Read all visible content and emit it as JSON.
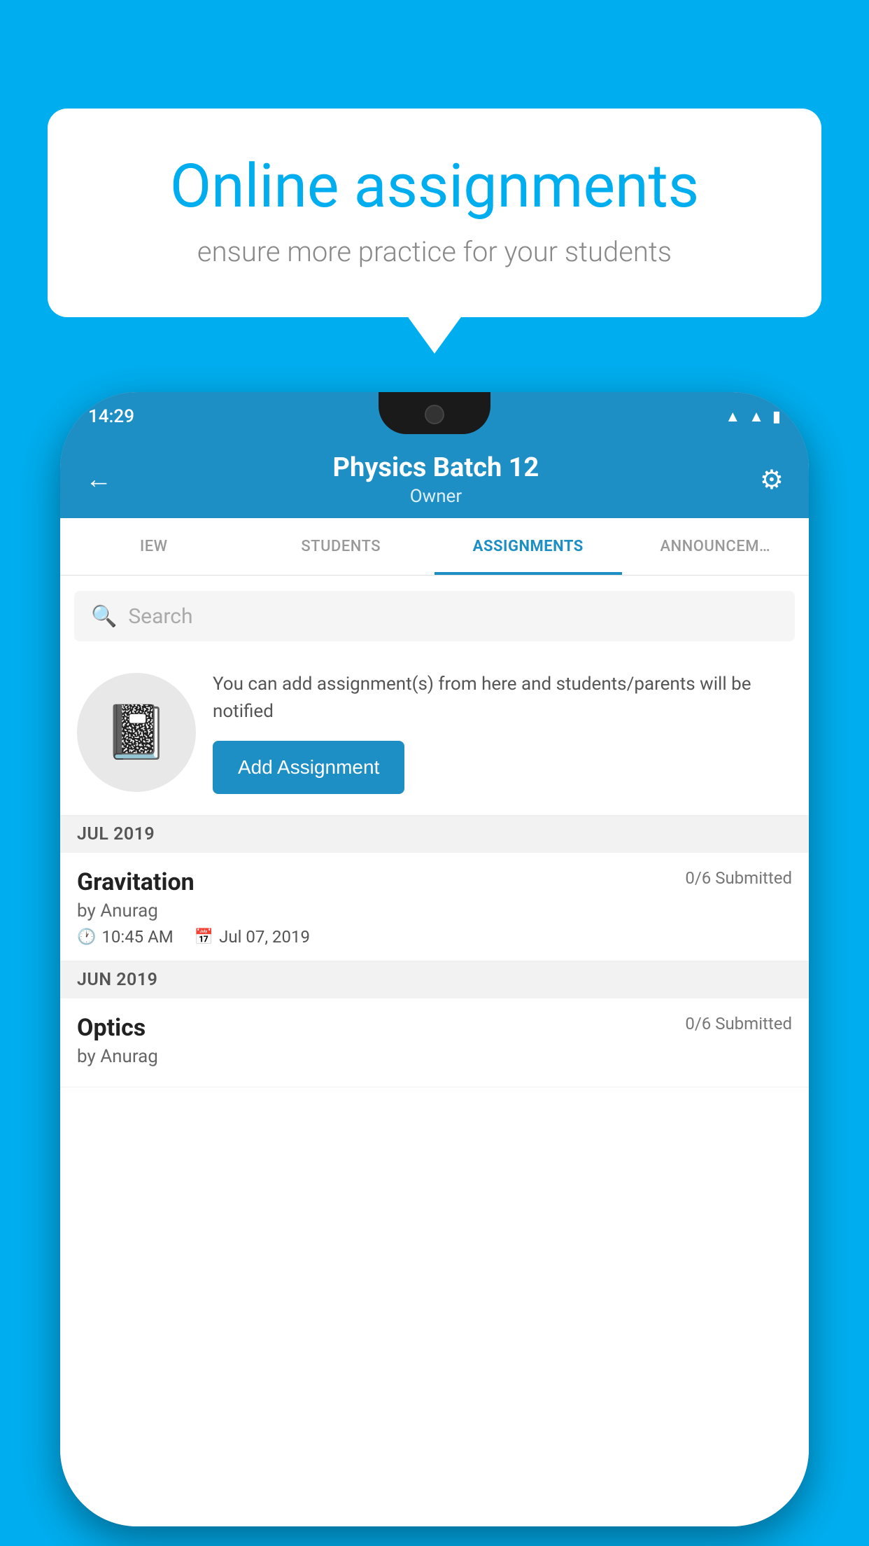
{
  "background": {
    "color": "#00AEEF"
  },
  "speech_bubble": {
    "title": "Online assignments",
    "subtitle": "ensure more practice for your students"
  },
  "phone": {
    "status_bar": {
      "time": "14:29"
    },
    "header": {
      "title": "Physics Batch 12",
      "subtitle": "Owner"
    },
    "tabs": [
      {
        "label": "IEW",
        "active": false
      },
      {
        "label": "STUDENTS",
        "active": false
      },
      {
        "label": "ASSIGNMENTS",
        "active": true
      },
      {
        "label": "ANNOUNCEM…",
        "active": false
      }
    ],
    "search": {
      "placeholder": "Search"
    },
    "promo": {
      "text": "You can add assignment(s) from here and students/parents will be notified",
      "button_label": "Add Assignment"
    },
    "sections": [
      {
        "header": "JUL 2019",
        "assignments": [
          {
            "title": "Gravitation",
            "submitted": "0/6 Submitted",
            "author": "by Anurag",
            "time": "10:45 AM",
            "date": "Jul 07, 2019"
          }
        ]
      },
      {
        "header": "JUN 2019",
        "assignments": [
          {
            "title": "Optics",
            "submitted": "0/6 Submitted",
            "author": "by Anurag",
            "time": "",
            "date": ""
          }
        ]
      }
    ]
  }
}
